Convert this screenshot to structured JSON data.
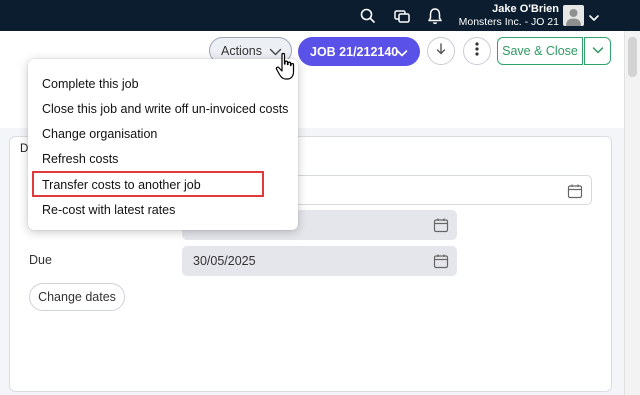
{
  "topbar": {
    "user_name": "Jake O'Brien",
    "user_org": "Monsters Inc. - JO 21",
    "icons": [
      "search-icon",
      "windows-icon",
      "bell-icon",
      "user-avatar-icon",
      "chevron-down-icon"
    ]
  },
  "header": {
    "actions_label": "Actions",
    "job_label": "JOB 21/212140",
    "save_close_label": "Save & Close"
  },
  "actions_menu": {
    "items": [
      "Complete this job",
      "Close this job and write off un-invoiced costs",
      "Change organisation",
      "Refresh costs",
      "Transfer costs to another job",
      "Re-cost with latest rates"
    ],
    "highlighted_item": "Transfer costs to another job"
  },
  "dates": {
    "heading": "D",
    "due_label": "Due",
    "due_value": "30/05/2025",
    "change_dates_label": "Change dates"
  },
  "colors": {
    "topbar": "#0b1d2e",
    "primary": "#5a51e8",
    "save_green": "#2e9a62",
    "highlight_red": "#e0393e"
  }
}
